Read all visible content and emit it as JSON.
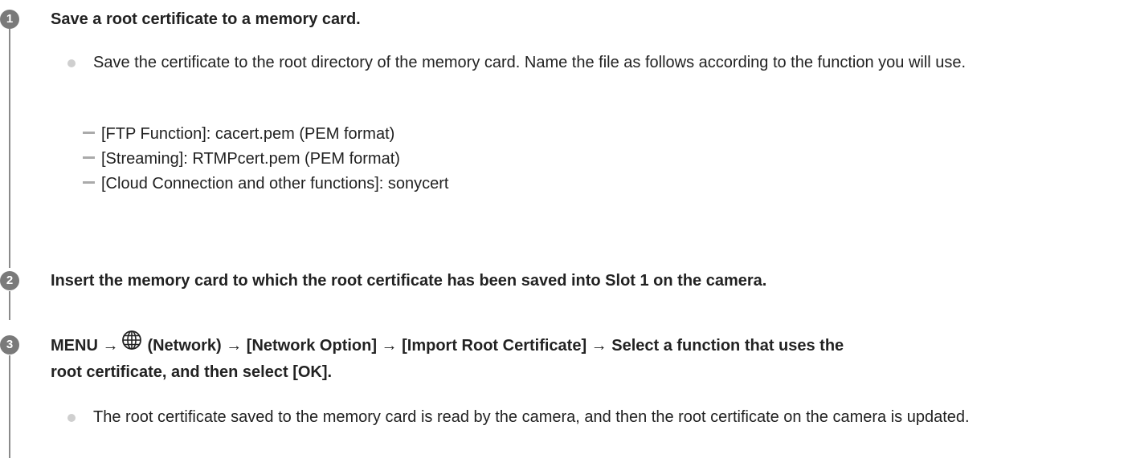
{
  "steps": [
    {
      "number": "1",
      "title": "Save a root certificate to a memory card.",
      "bullet": "Save the certificate to the root directory of the memory card. Name the file as follows according to the function you will use.",
      "subitems": [
        "[FTP Function]: cacert.pem (PEM format)",
        "[Streaming]: RTMPcert.pem (PEM format)",
        "[Cloud Connection and other functions]: sonycert"
      ]
    },
    {
      "number": "2",
      "title": "Insert the memory card to which the root certificate has been saved into Slot 1 on the camera."
    },
    {
      "number": "3",
      "title_prefix": "MENU →",
      "title_icon": "globe-icon",
      "title_rest": "(Network) → [Network Option] → [Import Root Certificate] → Select a function that uses the",
      "title_line2": "root certificate, and then select [OK].",
      "bullet": "The root certificate saved to the memory card is read by the camera, and then the root certificate on the camera is updated."
    }
  ],
  "colors": {
    "step_circle": "#7a7a7a",
    "bullet_dot": "#cfcfcf",
    "dash": "#aaaaaa",
    "text": "#222222"
  }
}
